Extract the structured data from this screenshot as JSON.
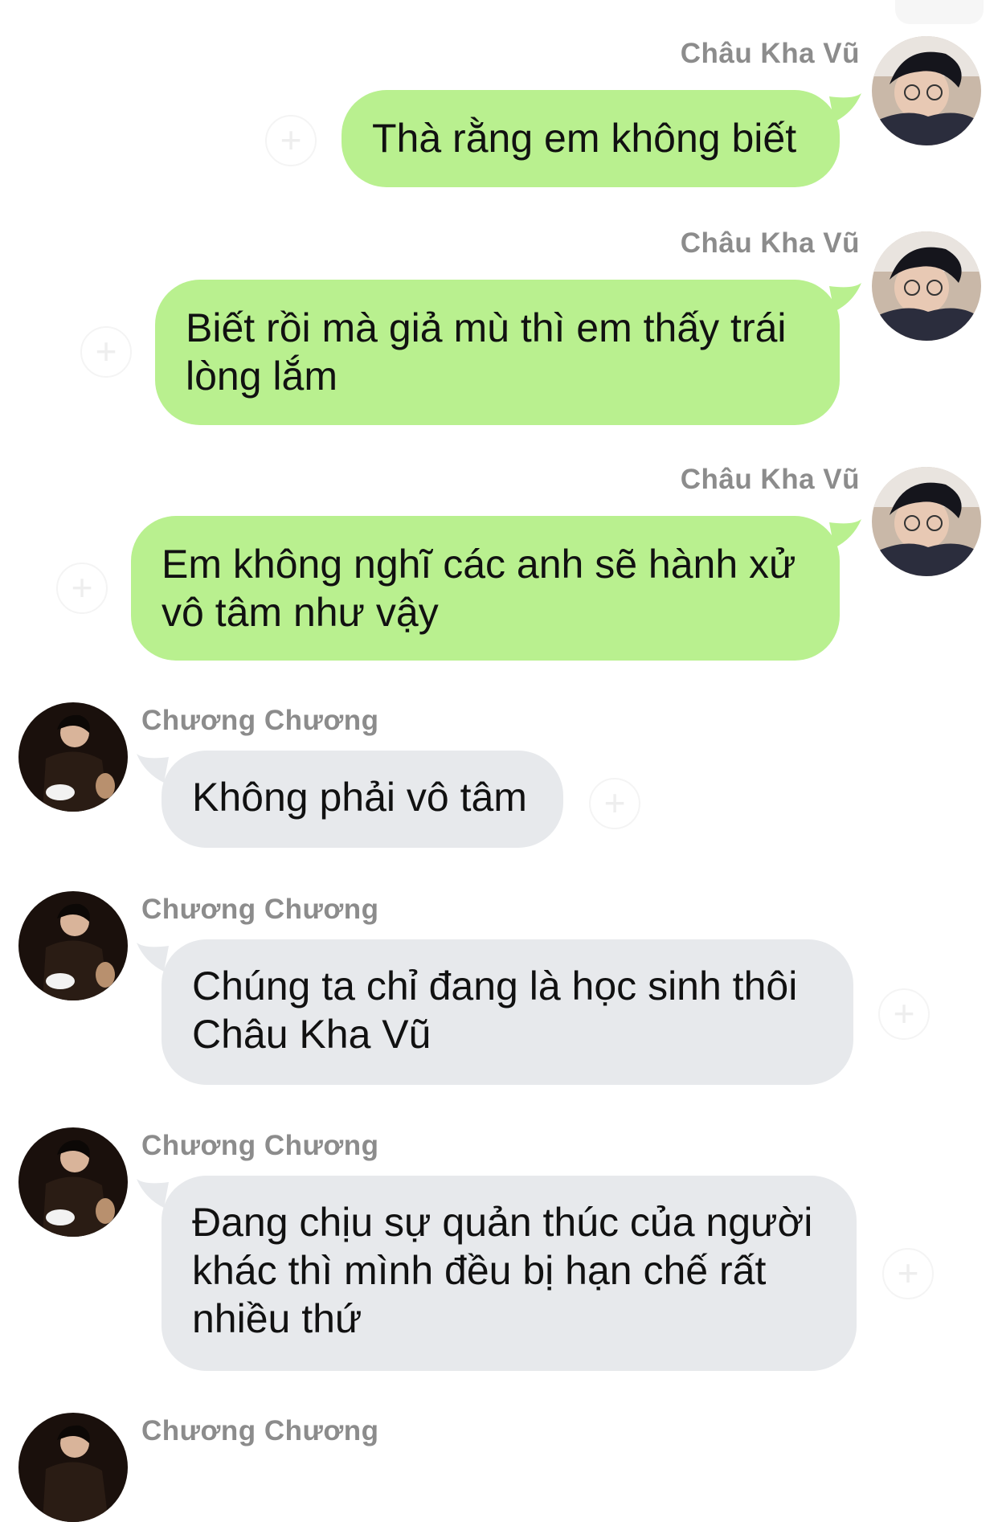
{
  "messages": [
    {
      "sender": "Châu Kha Vũ",
      "text": "Thà rằng em không biết"
    },
    {
      "sender": "Châu Kha Vũ",
      "text": "Biết rồi mà giả mù thì em thấy trái\nlòng lắm"
    },
    {
      "sender": "Châu Kha Vũ",
      "text": "Em không nghĩ các anh sẽ hành xử\nvô tâm như vậy"
    },
    {
      "sender": "Chương Chương",
      "text": "Không phải vô tâm"
    },
    {
      "sender": "Chương Chương",
      "text": "Chúng ta chỉ đang là học sinh thôi\nChâu Kha Vũ"
    },
    {
      "sender": "Chương Chương",
      "text": "Đang chịu sự quản thúc của người\nkhác thì mình đều bị hạn chế rất\nnhiều thứ"
    },
    {
      "sender": "Chương Chương",
      "text": ""
    }
  ],
  "reaction_icon": "add-reaction-icon",
  "colors": {
    "outgoing": "#b9f08f",
    "incoming": "#e7e9ec",
    "sender_name": "#8c8c8c"
  }
}
